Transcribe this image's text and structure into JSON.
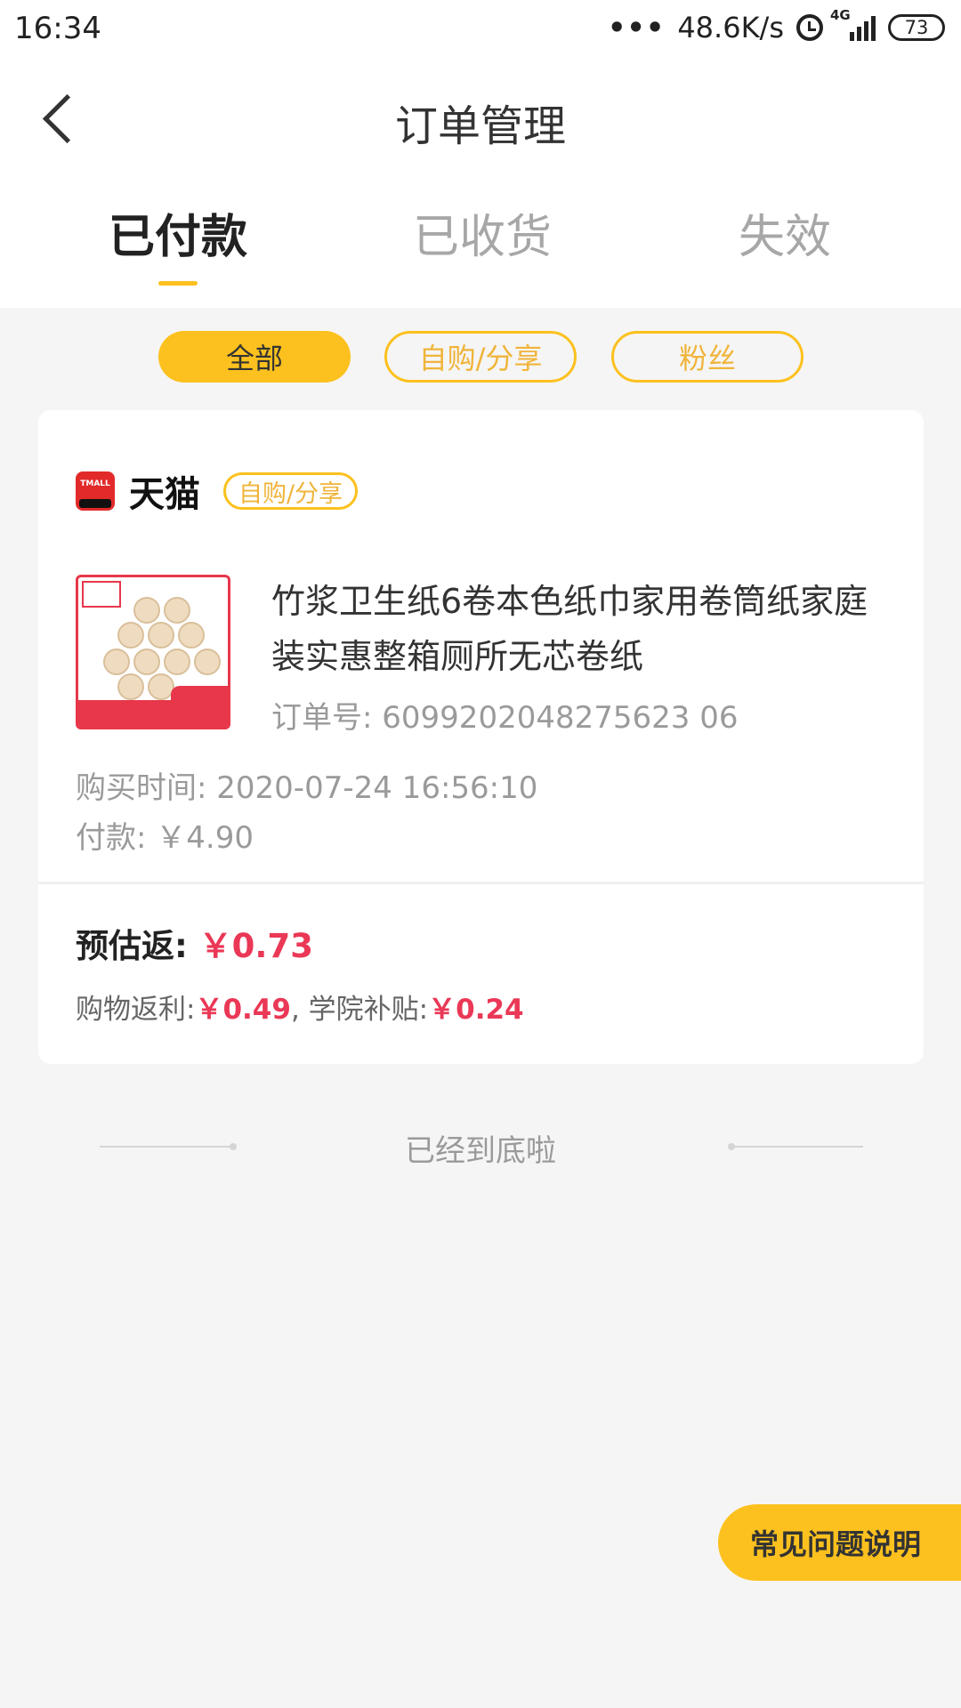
{
  "status_bar": {
    "time": "16:34",
    "dots": "•••",
    "net_speed": "48.6K/s",
    "network_type": "4G",
    "battery": "73"
  },
  "nav": {
    "title": "订单管理"
  },
  "tabs": [
    {
      "label": "已付款",
      "active": true
    },
    {
      "label": "已收货",
      "active": false
    },
    {
      "label": "失效",
      "active": false
    }
  ],
  "filters": [
    {
      "label": "全部",
      "selected": true
    },
    {
      "label": "自购/分享",
      "selected": false
    },
    {
      "label": "粉丝",
      "selected": false
    }
  ],
  "order": {
    "shop_name": "天猫",
    "shop_logo_text": "TMALL",
    "tag": "自购/分享",
    "product_title": "竹浆卫生纸6卷本色纸巾家用卷筒纸家庭装实惠整箱厕所无芯卷纸",
    "order_no_label": "订单号:",
    "order_no": "6099202048275623 06",
    "purchase_time_label": "购买时间:",
    "purchase_time": "2020-07-24 16:56:10",
    "payment_label": "付款:",
    "payment": "￥4.90",
    "estimate_label": "预估返:",
    "estimate_value": "￥0.73",
    "rebate_label": "购物返利:",
    "rebate_value": "￥0.49",
    "separator": ",",
    "subsidy_label": "学院补贴:",
    "subsidy_value": "￥0.24"
  },
  "list_end_text": "已经到底啦",
  "faq_button": "常见问题说明",
  "colors": {
    "accent_yellow": "#fcc11e",
    "price_red": "#ea3856",
    "tmall_red": "#e22a2a"
  }
}
